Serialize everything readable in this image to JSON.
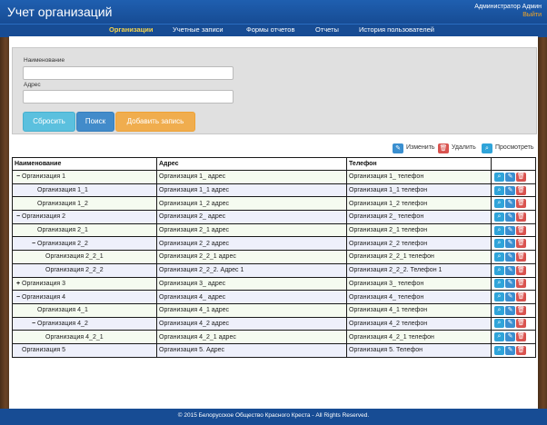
{
  "header": {
    "title": "Учет организаций",
    "user": "Администратор Админ",
    "logout": "Выйти"
  },
  "nav": [
    {
      "label": "Организации",
      "active": true
    },
    {
      "label": "Учетные записи"
    },
    {
      "label": "Формы отчетов"
    },
    {
      "label": "Отчеты"
    },
    {
      "label": "История пользователей"
    }
  ],
  "form": {
    "name_label": "Наименование",
    "name_value": "",
    "address_label": "Адрес",
    "address_value": "",
    "reset": "Сбросить",
    "search": "Поиск",
    "add": "Добавить запись"
  },
  "legend": {
    "edit": "Изменить",
    "delete": "Удалить",
    "view": "Просмотреть"
  },
  "table": {
    "headers": [
      "Наименование",
      "Адрес",
      "Телефон",
      ""
    ],
    "rows": [
      {
        "toggle": "−",
        "name": "Организация 1",
        "address": "Организация 1_ адрес",
        "phone": "Организация 1_ телефон",
        "level": 0
      },
      {
        "toggle": "",
        "name": "Организация 1_1",
        "address": "Организация 1_1 адрес",
        "phone": "Организация 1_1 телефон",
        "level": 1
      },
      {
        "toggle": "",
        "name": "Организация 1_2",
        "address": "Организация 1_2 адрес",
        "phone": "Организация 1_2 телефон",
        "level": 1
      },
      {
        "toggle": "−",
        "name": "Организация 2",
        "address": "Организация 2_ адрес",
        "phone": "Организация 2_ телефон",
        "level": 0
      },
      {
        "toggle": "",
        "name": "Организация 2_1",
        "address": "Организация 2_1 адрес",
        "phone": "Организация 2_1 телефон",
        "level": 1
      },
      {
        "toggle": "−",
        "name": "Организация 2_2",
        "address": "Организация 2_2 адрес",
        "phone": "Организация 2_2 телефон",
        "level": 1
      },
      {
        "toggle": "",
        "name": "Организация 2_2_1",
        "address": "Организация 2_2_1 адрес",
        "phone": "Организация 2_2_1 телефон",
        "level": 2
      },
      {
        "toggle": "",
        "name": "Организация 2_2_2",
        "address": "Организация 2_2_2. Адрес 1",
        "phone": "Организация 2_2_2. Телефон 1",
        "level": 2
      },
      {
        "toggle": "+",
        "name": "Организация 3",
        "address": "Организация 3_ адрес",
        "phone": "Организация 3_ телефон",
        "level": 0
      },
      {
        "toggle": "−",
        "name": "Организация 4",
        "address": "Организация 4_ адрес",
        "phone": "Организация 4_ телефон",
        "level": 0
      },
      {
        "toggle": "",
        "name": "Организация 4_1",
        "address": "Организация 4_1 адрес",
        "phone": "Организация 4_1 телефон",
        "level": 1
      },
      {
        "toggle": "−",
        "name": "Организация 4_2",
        "address": "Организация 4_2 адрес",
        "phone": "Организация 4_2 телефон",
        "level": 1
      },
      {
        "toggle": "",
        "name": "Организация 4_2_1",
        "address": "Организация 4_2_1 адрес",
        "phone": "Организация 4_2_1 телефон",
        "level": 2
      },
      {
        "toggle": "",
        "name": "Организация 5",
        "address": "Организация 5. Адрес",
        "phone": "Организация 5. Телефон",
        "level": 0
      }
    ]
  },
  "icons": {
    "view": "search-icon",
    "edit": "pencil-icon",
    "delete": "trash-icon"
  },
  "colors": {
    "header": "#174c94",
    "active_nav": "#f7d44a",
    "logout": "#f5a623",
    "reset": "#5bc0de",
    "search": "#428bca",
    "add": "#f0ad4e",
    "delete": "#d9534f",
    "view": "#2fa4d9"
  },
  "footer": "© 2015 Белорусское Общество Красного Креста  -   All Rights Reserved."
}
